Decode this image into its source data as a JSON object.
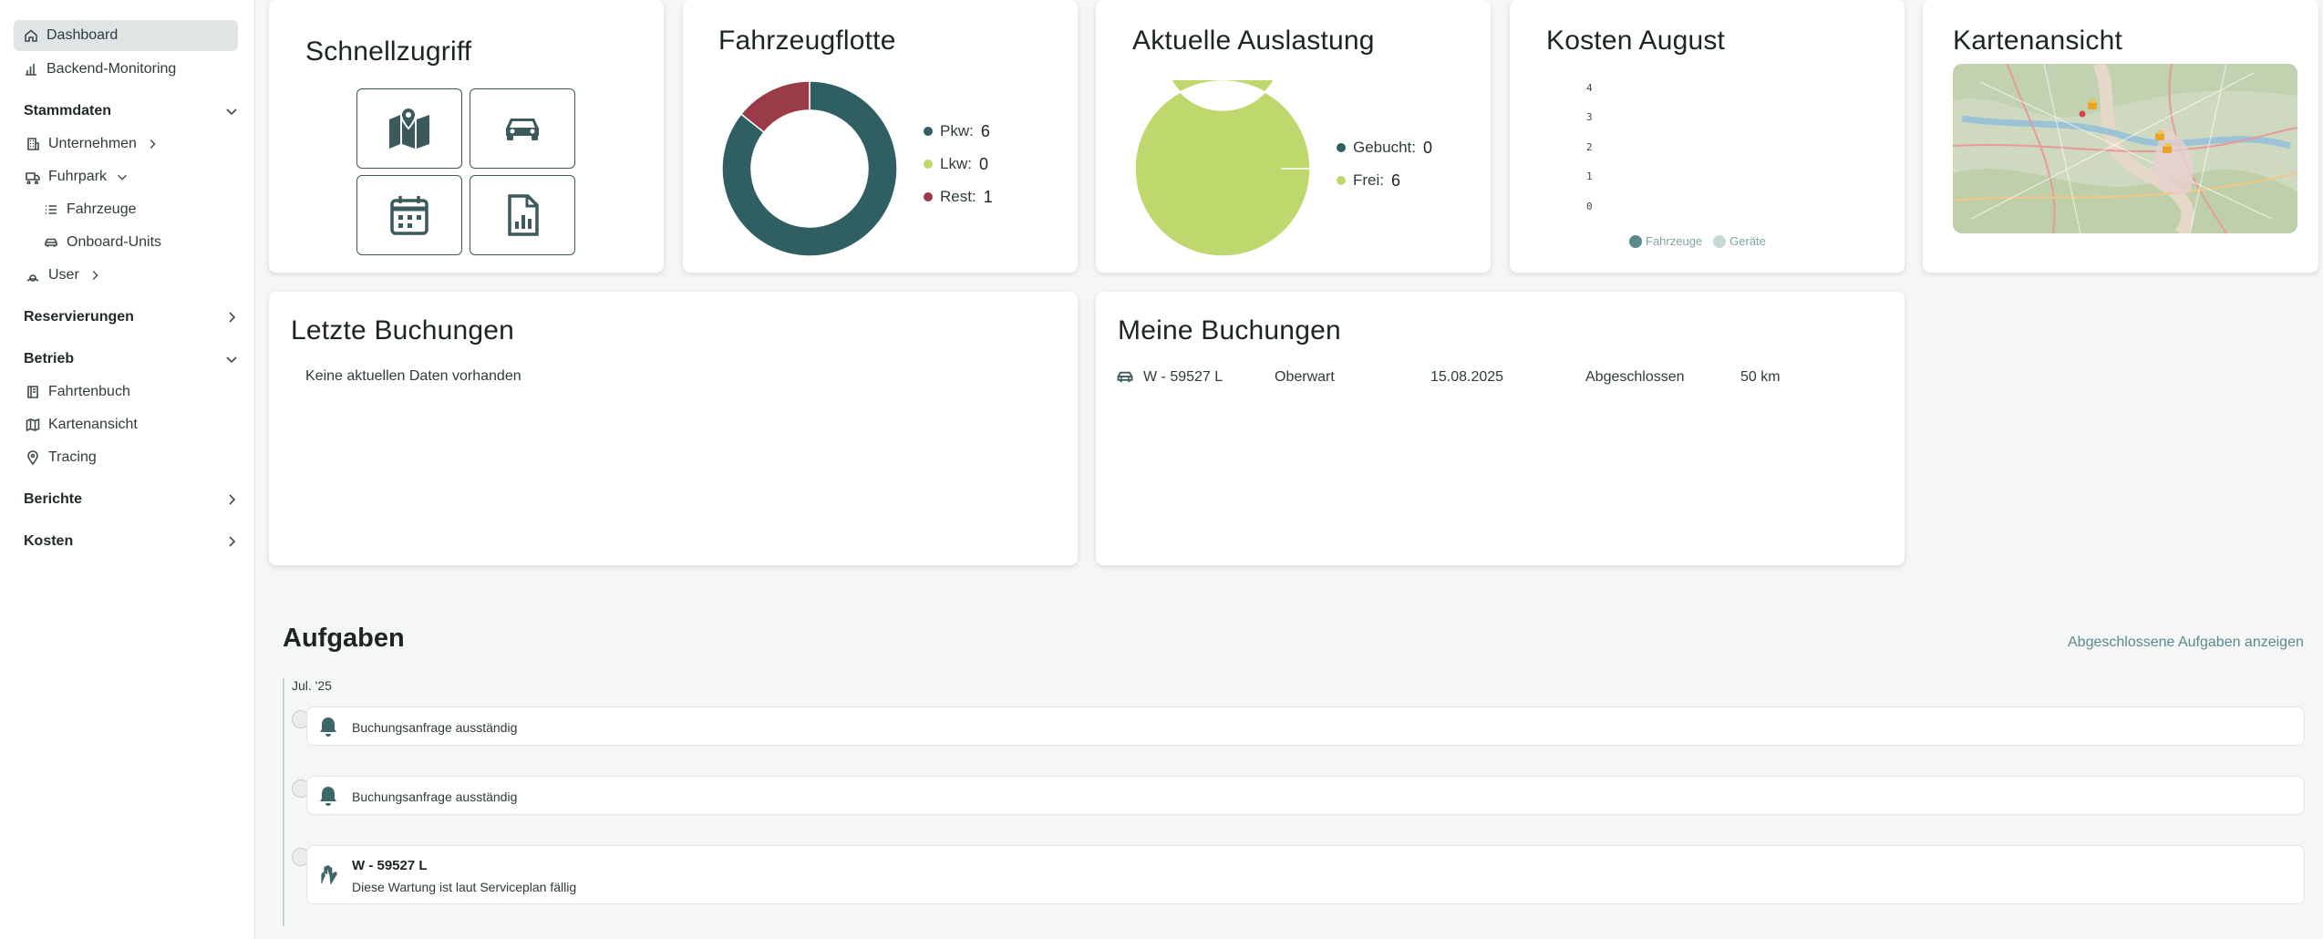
{
  "sidebar": {
    "items": [
      {
        "label": "Dashboard",
        "icon": "home-icon"
      },
      {
        "label": "Backend-Monitoring",
        "icon": "bar-chart-icon"
      }
    ],
    "stammdaten": {
      "label": "Stammdaten",
      "items": {
        "unternehmen": "Unternehmen",
        "fuhrpark": "Fuhrpark",
        "fahrzeuge": "Fahrzeuge",
        "onboard_units": "Onboard-Units",
        "user": "User"
      }
    },
    "reservierungen": "Reservierungen",
    "betrieb": {
      "label": "Betrieb",
      "items": {
        "fahrtenbuch": "Fahrtenbuch",
        "kartenansicht": "Kartenansicht",
        "tracing": "Tracing"
      }
    },
    "berichte": "Berichte",
    "kosten": "Kosten"
  },
  "cards": {
    "schnellzugriff": {
      "title": "Schnellzugriff",
      "buttons": [
        "map-icon",
        "car-icon",
        "calendar-icon",
        "report-icon"
      ]
    },
    "fahrzeugflotte": {
      "title": "Fahrzeugflotte"
    },
    "auslastung": {
      "title": "Aktuelle Auslastung"
    },
    "kosten": {
      "title": "Kosten August"
    },
    "karte": {
      "title": "Kartenansicht"
    },
    "letzte_buchungen": {
      "title": "Letzte Buchungen",
      "empty": "Keine aktuellen Daten vorhanden"
    },
    "meine_buchungen": {
      "title": "Meine Buchungen",
      "rows": [
        {
          "plate": "W - 59527 L",
          "location": "Oberwart",
          "date": "15.08.2025",
          "status": "Abgeschlossen",
          "distance": "50 km"
        }
      ]
    }
  },
  "chart_data": [
    {
      "type": "pie",
      "title": "Fahrzeugflotte",
      "donut": true,
      "categories": [
        "Pkw",
        "Lkw",
        "Rest"
      ],
      "values": [
        6,
        0,
        1
      ],
      "colors": [
        "#2f5f62",
        "#bed86e",
        "#9a3b48"
      ],
      "legend": "right"
    },
    {
      "type": "pie",
      "title": "Aktuelle Auslastung",
      "donut": true,
      "categories": [
        "Gebucht",
        "Frei"
      ],
      "values": [
        0,
        6
      ],
      "colors": [
        "#2f5f62",
        "#bed86e"
      ],
      "legend": "right"
    },
    {
      "type": "bar",
      "title": "Kosten August",
      "categories": [],
      "series": [
        {
          "name": "Fahrzeuge",
          "values": [],
          "color": "#5b8a8a"
        },
        {
          "name": "Geräte",
          "values": [],
          "color": "#c8d8d8"
        }
      ],
      "yticks": [
        "4",
        "3",
        "2",
        "1",
        "0"
      ],
      "ylim": [
        0,
        4
      ],
      "legend": "bottom"
    }
  ],
  "tasks": {
    "title": "Aufgaben",
    "link": "Abgeschlossene Aufgaben anzeigen",
    "month": "Jul. '25",
    "items": [
      {
        "icon": "bell-icon",
        "text": "Buchungsanfrage ausständig"
      },
      {
        "icon": "bell-icon",
        "text": "Buchungsanfrage ausständig"
      },
      {
        "icon": "wrench-hand-icon",
        "title": "W - 59527 L",
        "text": "Diese Wartung ist laut Serviceplan fällig"
      }
    ]
  },
  "colors": {
    "primary": "#2f5f62",
    "lime": "#bed86e",
    "red": "#9a3b48",
    "link": "#5b8a8a"
  }
}
